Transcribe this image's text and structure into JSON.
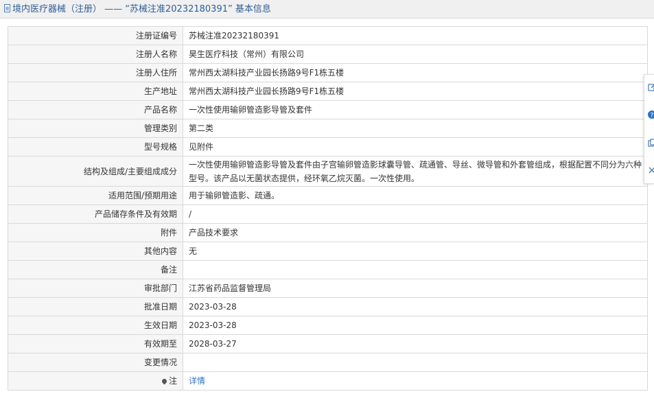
{
  "header": {
    "title": "境内医疗器械（注册） —— “苏械注准20232180391” 基本信息"
  },
  "rows": [
    {
      "label": "注册证编号",
      "value": "苏械注准20232180391"
    },
    {
      "label": "注册人名称",
      "value": "昊生医疗科技（常州）有限公司"
    },
    {
      "label": "注册人住所",
      "value": "常州西太湖科技产业园长扬路9号F1栋五楼"
    },
    {
      "label": "生产地址",
      "value": "常州西太湖科技产业园长扬路9号F1栋五楼"
    },
    {
      "label": "产品名称",
      "value": "一次性使用输卵管造影导管及套件"
    },
    {
      "label": "管理类别",
      "value": "第二类"
    },
    {
      "label": "型号规格",
      "value": "见附件"
    },
    {
      "label": "结构及组成/主要组成成分",
      "value": "一次性使用输卵管造影导管及套件由子宫输卵管造影球囊导管、疏通管、导丝、微导管和外套管组成，根据配置不同分为六种型号。该产品以无菌状态提供，经环氧乙烷灭菌。一次性使用。"
    },
    {
      "label": "适用范围/预期用途",
      "value": "用于输卵管造影、疏通。"
    },
    {
      "label": "产品储存条件及有效期",
      "value": "/"
    },
    {
      "label": "附件",
      "value": "产品技术要求"
    },
    {
      "label": "其他内容",
      "value": "无"
    },
    {
      "label": "备注",
      "value": ""
    },
    {
      "label": "审批部门",
      "value": "江苏省药品监督管理局"
    },
    {
      "label": "批准日期",
      "value": "2023-03-28"
    },
    {
      "label": "生效日期",
      "value": "2023-03-28"
    },
    {
      "label": "有效期至",
      "value": "2028-03-27"
    },
    {
      "label": "变更情况",
      "value": ""
    }
  ],
  "note_row": {
    "label": "注",
    "link": "详情"
  },
  "icons": {
    "title": "document-icon",
    "note": "pin-icon",
    "side_tools": [
      "edit-icon",
      "help-icon",
      "copy-icon",
      "close-icon"
    ]
  },
  "colors": {
    "title_text": "#2f5d96",
    "link": "#2f73c8",
    "label_bg": "#f6f6f6",
    "border": "#d8d8d8"
  }
}
